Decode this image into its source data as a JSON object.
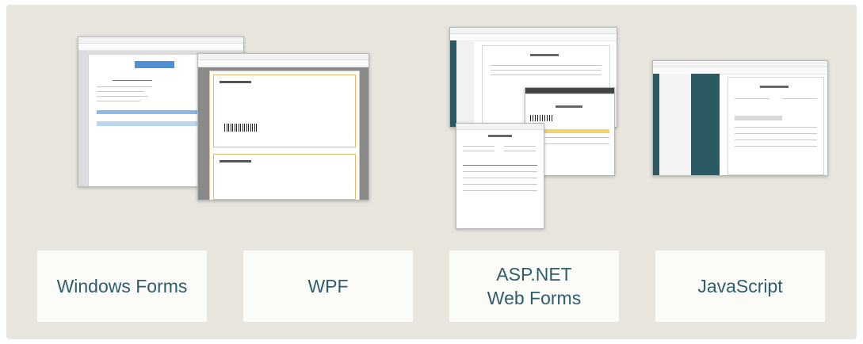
{
  "platforms": [
    {
      "label_lines": [
        "Windows Forms"
      ]
    },
    {
      "label_lines": [
        "WPF"
      ]
    },
    {
      "label_lines": [
        "ASP.NET",
        "Web Forms"
      ]
    },
    {
      "label_lines": [
        "JavaScript"
      ]
    }
  ],
  "colors": {
    "background": "#e8e6dc",
    "tile": "#fbfbf8",
    "label_text": "#2f5d6c",
    "sidebar": "#2b5a62"
  },
  "thumbnails": [
    {
      "platform": "Windows Forms",
      "icon": "report-preview-window"
    },
    {
      "platform": "WPF",
      "icon": "report-preview-window"
    },
    {
      "platform": "ASP.NET Web Forms",
      "icon": "browser-report-viewer"
    },
    {
      "platform": "JavaScript",
      "icon": "browser-report-viewer"
    }
  ]
}
